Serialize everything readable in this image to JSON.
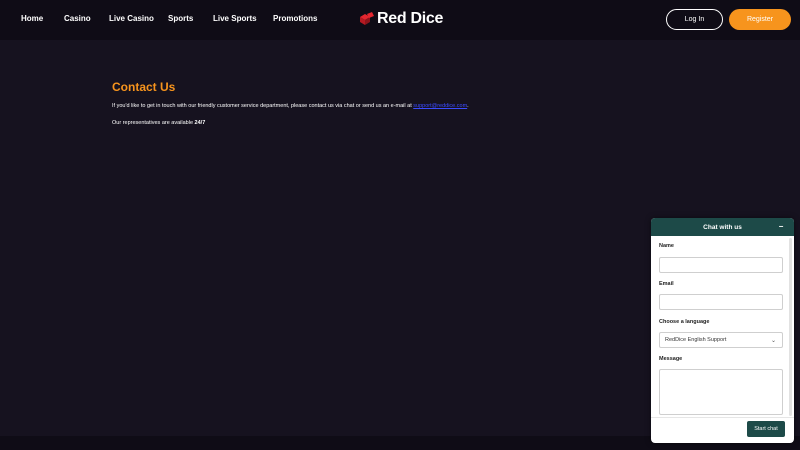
{
  "nav": {
    "items": [
      {
        "label": "Home"
      },
      {
        "label": "Casino"
      },
      {
        "label": "Live Casino"
      },
      {
        "label": "Sports"
      },
      {
        "label": "Live Sports"
      },
      {
        "label": "Promotions"
      }
    ]
  },
  "logo": {
    "text": "Red Dice",
    "icon": "dice-icon",
    "icon_color": "#e3262f"
  },
  "auth": {
    "login_label": "Log In",
    "register_label": "Register"
  },
  "colors": {
    "accent": "#f7941d",
    "chat": "#1d4a48",
    "background": "#16121f"
  },
  "content": {
    "title": "Contact Us",
    "para_before": "If you'd like to get in touch with our friendly customer service department, please contact us via chat or send us an e-mail at ",
    "email": "support@reddice.com",
    "para_after": ".",
    "para2_prefix": "Our representatives are available ",
    "para2_bold": "24/7"
  },
  "chat": {
    "title": "Chat with us",
    "minimize_icon": "minimize-icon",
    "name_label": "Name",
    "name_value": "",
    "email_label": "Email",
    "email_value": "",
    "language_label": "Choose a language",
    "language_selected": "RedDice English Support",
    "message_label": "Message",
    "start_label": "Start chat"
  }
}
